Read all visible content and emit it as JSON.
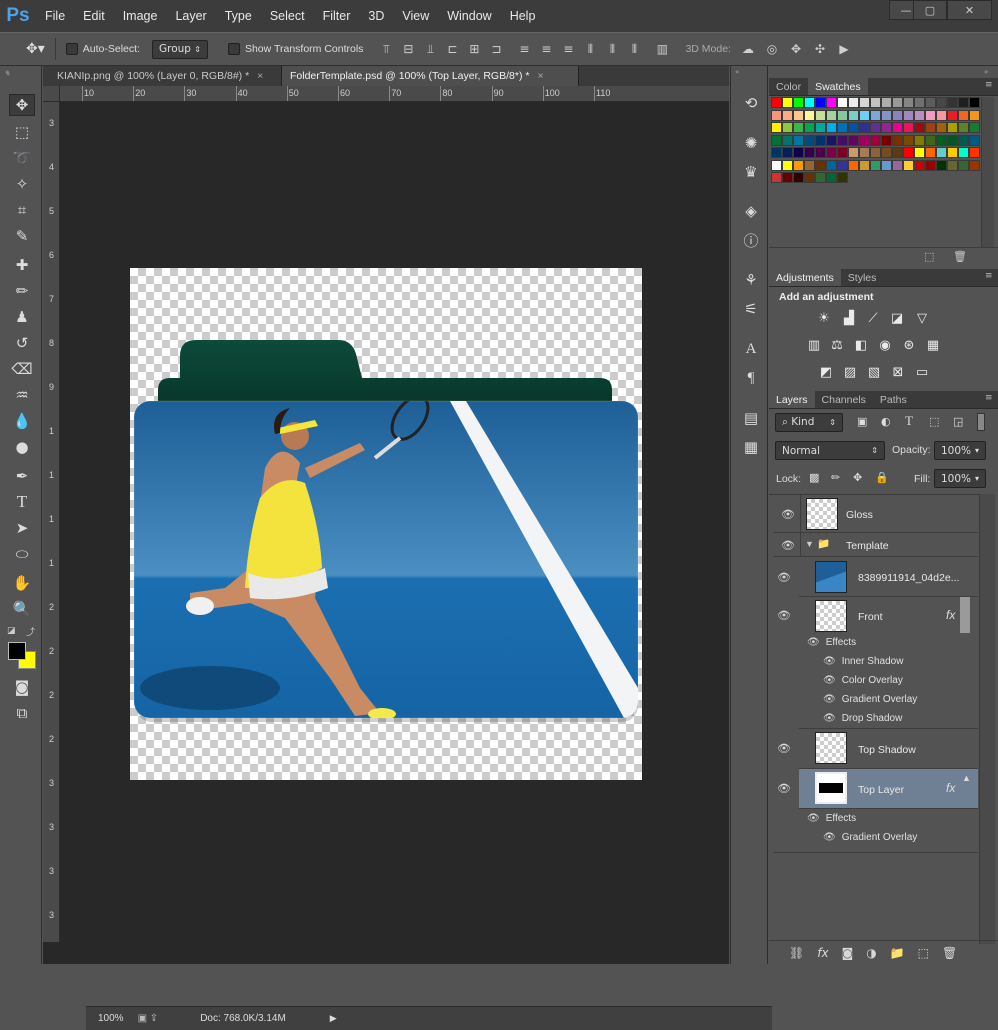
{
  "app": {
    "logo": "Ps"
  },
  "menu": [
    "File",
    "Edit",
    "Image",
    "Layer",
    "Type",
    "Select",
    "Filter",
    "3D",
    "View",
    "Window",
    "Help"
  ],
  "window_controls": {
    "minimize": "—",
    "maximize": "▢",
    "close": "✕"
  },
  "options": {
    "auto_select_label": "Auto-Select:",
    "auto_select_value": "Group",
    "show_transform_label": "Show Transform Controls",
    "mode_3d_label": "3D Mode:"
  },
  "tabs": [
    {
      "label": "KIANIp.png @ 100% (Layer 0, RGB/8#) *",
      "close": "×"
    },
    {
      "label": "FolderTemplate.psd @ 100% (Top Layer, RGB/8*) *",
      "close": "×"
    }
  ],
  "ruler": {
    "h_ticks": [
      "10",
      "20",
      "30",
      "40",
      "50",
      "60",
      "70",
      "80",
      "90",
      "100",
      "110"
    ],
    "v_ticks": [
      "3",
      "4",
      "5",
      "6",
      "7",
      "8",
      "9",
      "1",
      "1",
      "1",
      "1",
      "2",
      "2",
      "2",
      "2",
      "3",
      "3",
      "3",
      "3"
    ]
  },
  "status": {
    "zoom": "100%",
    "doc": "Doc: 768.0K/3.14M"
  },
  "swatches_panel": {
    "tabs": [
      "Color",
      "Swatches"
    ],
    "colors": [
      "#ff0000",
      "#ffff00",
      "#00ff00",
      "#00ffff",
      "#0000ff",
      "#ff00ff",
      "#ffffff",
      "#ebebeb",
      "#d6d6d6",
      "#c2c2c2",
      "#adadad",
      "#999999",
      "#858585",
      "#707070",
      "#5c5c5c",
      "#474747",
      "#333333",
      "#1f1f1f",
      "#000000",
      "#f7977a",
      "#f9ad81",
      "#fdc68a",
      "#fff79a",
      "#c4df9b",
      "#a2d39c",
      "#82ca9d",
      "#7bcdc8",
      "#6ecff6",
      "#7ea7d8",
      "#8493ca",
      "#8882be",
      "#a187be",
      "#bc8dbf",
      "#f49ac2",
      "#f6989d",
      "#ed1c24",
      "#f26522",
      "#f7941d",
      "#fff200",
      "#8dc63f",
      "#39b54a",
      "#00a651",
      "#00a99d",
      "#00aeef",
      "#0072bc",
      "#0054a6",
      "#2e3192",
      "#662d91",
      "#92278f",
      "#ec008c",
      "#ed145b",
      "#9e0b0f",
      "#a0410d",
      "#a36209",
      "#aba000",
      "#598527",
      "#1a7b30",
      "#007236",
      "#00746b",
      "#0076a3",
      "#004b80",
      "#003471",
      "#1b1464",
      "#440e62",
      "#630460",
      "#9e005d",
      "#9e0039",
      "#790000",
      "#7b2e00",
      "#7d4900",
      "#827b00",
      "#406618",
      "#005e20",
      "#005826",
      "#005952",
      "#005b7f",
      "#003663",
      "#002157",
      "#0d004c",
      "#32004b",
      "#4b0049",
      "#7b0046",
      "#7a0026",
      "#c69c6d",
      "#a67c52",
      "#8c6239",
      "#754c24",
      "#603913",
      "#ff0000",
      "#ffff00",
      "#ff6600",
      "#66cccc",
      "#ffcc00",
      "#00ffcc",
      "#ff3300",
      "#ffffff",
      "#ffff00",
      "#ff9900",
      "#996633",
      "#663300",
      "#006699",
      "#333399",
      "#ff6600",
      "#cc9933",
      "#339966",
      "#6699cc",
      "#996699",
      "#ffcc33",
      "#cc0000",
      "#990000",
      "#003300",
      "#666633",
      "#336633",
      "#993300"
    ]
  },
  "adjustments_panel": {
    "tabs": [
      "Adjustments",
      "Styles"
    ],
    "title": "Add an adjustment"
  },
  "layers_panel": {
    "tabs": [
      "Layers",
      "Channels",
      "Paths"
    ],
    "kind": "Kind",
    "blend_mode": "Normal",
    "opacity_label": "Opacity:",
    "opacity": "100%",
    "lock_label": "Lock:",
    "fill_label": "Fill:",
    "fill": "100%",
    "layers": [
      {
        "name": "Gloss"
      },
      {
        "name": "Template"
      },
      {
        "name": "8389911914_04d2e..."
      },
      {
        "name": "Front",
        "fx": "fx"
      },
      {
        "name": "Top Shadow"
      },
      {
        "name": "Top Layer",
        "fx": "fx"
      }
    ],
    "front_effects": {
      "title": "Effects",
      "items": [
        "Inner Shadow",
        "Color Overlay",
        "Gradient Overlay",
        "Drop Shadow"
      ]
    },
    "top_effects": {
      "title": "Effects",
      "items": [
        "Gradient Overlay"
      ]
    },
    "bottom_icons": [
      "link-icon",
      "fx-icon",
      "mask-icon",
      "adjustment-icon",
      "group-icon",
      "new-layer-icon",
      "trash-icon"
    ]
  }
}
